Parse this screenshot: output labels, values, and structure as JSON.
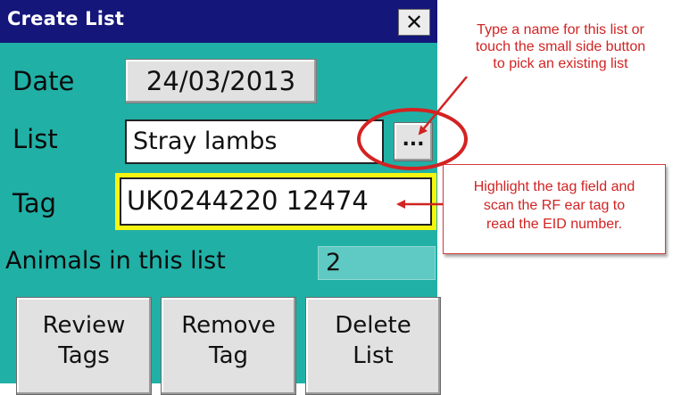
{
  "window": {
    "title": "Create List",
    "close_label": "✕"
  },
  "form": {
    "date_label": "Date",
    "date_value": "24/03/2013",
    "list_label": "List",
    "list_value": "Stray lambs",
    "pick_label": "...",
    "tag_label": "Tag",
    "tag_value": "UK0244220 12474",
    "count_label": "Animals in this list",
    "count_value": "2"
  },
  "buttons": {
    "review": [
      "Review",
      "Tags"
    ],
    "remove": [
      "Remove",
      "Tag"
    ],
    "delete": [
      "Delete",
      "List"
    ]
  },
  "annotations": {
    "list_note": [
      "Type a name for this list or",
      "touch the small side button",
      "to pick an existing list"
    ],
    "tag_note": [
      "Highlight the tag field and",
      "scan the RF ear tag to",
      "read the EID number."
    ]
  },
  "colors": {
    "window_bg": "#21b0a6",
    "titlebar_bg": "#14167a",
    "tag_highlight": "#f5f510",
    "annotation_red": "#d22323"
  },
  "icons": {
    "close": "close-icon",
    "pick": "ellipsis-icon"
  }
}
